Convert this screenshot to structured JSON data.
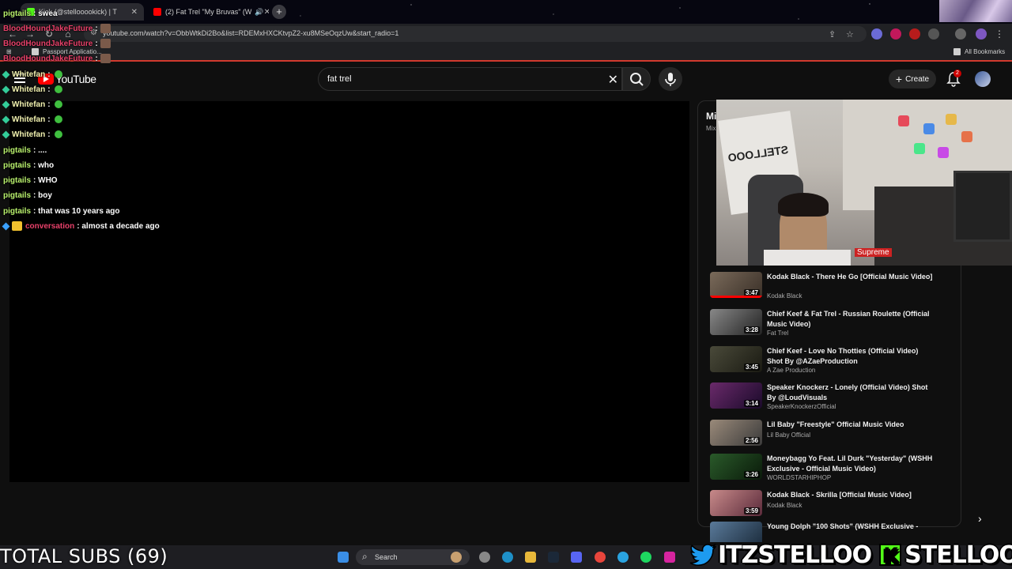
{
  "browser": {
    "tabs": [
      {
        "label": "Kick (@stellooookick) | T"
      },
      {
        "label": "(2) Fat Trel \"My Bruvas\" (W"
      }
    ],
    "url": "youtube.com/watch?v=ObbWtkDi2Bo&list=RDEMxHXCKtvpZ2-xu8MSeOqzUw&start_radio=1",
    "bookmarks": [
      {
        "label": "Passport Applicatio..."
      },
      {
        "label": "All Bookmarks"
      }
    ]
  },
  "youtube": {
    "logo": "YouTube",
    "search_query": "fat trel",
    "create_label": "Create",
    "notification_count": "2"
  },
  "chat": [
    {
      "user": "pigtails",
      "text": "swea",
      "color": "#b8f06c"
    },
    {
      "user": "BloodHoundJakeFuture",
      "text": "",
      "color": "#e8416a"
    },
    {
      "user": "BloodHoundJakeFuture",
      "text": "",
      "color": "#e8416a"
    },
    {
      "user": "BloodHoundJakeFuture",
      "text": "",
      "color": "#e8416a"
    },
    {
      "user": "Whitefan",
      "text": "",
      "color": "#f2f2b0"
    },
    {
      "user": "Whitefan",
      "text": "",
      "color": "#f2f2b0"
    },
    {
      "user": "Whitefan",
      "text": "",
      "color": "#f2f2b0"
    },
    {
      "user": "Whitefan",
      "text": "",
      "color": "#f2f2b0"
    },
    {
      "user": "Whitefan",
      "text": "",
      "color": "#f2f2b0"
    },
    {
      "user": "pigtails",
      "text": "....",
      "color": "#b8f06c"
    },
    {
      "user": "pigtails",
      "text": "who",
      "color": "#b8f06c"
    },
    {
      "user": "pigtails",
      "text": "WHO",
      "color": "#b8f06c"
    },
    {
      "user": "pigtails",
      "text": "boy",
      "color": "#b8f06c"
    },
    {
      "user": "pigtails",
      "text": "that was 10 years ago",
      "color": "#b8f06c"
    },
    {
      "user": "conversation",
      "text": "almost a decade ago",
      "color": "#e8416a"
    }
  ],
  "sidebar": {
    "mix_title": "Mi",
    "mix_sub": "Mix",
    "videos": [
      {
        "title": "Kodak Black - There He Go [Official Music Video]",
        "channel": "Kodak Black",
        "duration": "3:47"
      },
      {
        "title": "Chief Keef & Fat Trel - Russian Roulette (Official Music Video)",
        "channel": "Fat Trel",
        "duration": "3:28"
      },
      {
        "title": "Chief Keef - Love No Thotties (Official Video) Shot By @AZaeProduction",
        "channel": "A Zae Production",
        "duration": "3:45"
      },
      {
        "title": "Speaker Knockerz - Lonely (Official Video) Shot By @LoudVisuals",
        "channel": "SpeakerKnockerzOfficial",
        "duration": "3:14"
      },
      {
        "title": "Lil Baby \"Freestyle\" Official Music Video",
        "channel": "Lil Baby Official",
        "duration": "2:56"
      },
      {
        "title": "Moneybagg Yo Feat. Lil Durk \"Yesterday\" (WSHH Exclusive - Official Music Video)",
        "channel": "WORLDSTARHIPHOP",
        "duration": "3:26"
      },
      {
        "title": "Kodak Black - Skrilla [Official Music Video]",
        "channel": "Kodak Black",
        "duration": "3:59"
      },
      {
        "title": "Young Dolph \"100 Shots\" (WSHH Exclusive -",
        "channel": "",
        "duration": ""
      }
    ]
  },
  "overlay": {
    "total_subs": "TOTAL SUBS (69)",
    "twitter_handle": "ITZSTELLOO",
    "kick_handle": "STELLOOO"
  },
  "taskbar": {
    "search_label": "Search"
  }
}
